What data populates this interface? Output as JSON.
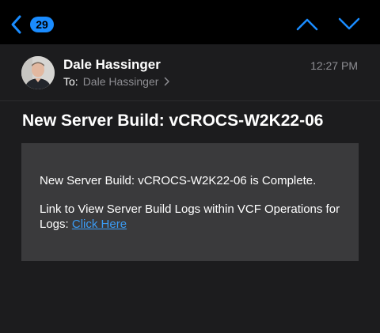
{
  "nav": {
    "unread_count": "29",
    "accent_color": "#1a8cff",
    "back_icon": "chevron-left-icon",
    "prev_icon": "chevron-up-icon",
    "next_icon": "chevron-down-icon"
  },
  "message": {
    "sender_name": "Dale Hassinger",
    "time": "12:27 PM",
    "to_label": "To:",
    "to_name": "Dale Hassinger",
    "subject": "New Server Build: vCROCS-W2K22-06",
    "body_line1": "New Server Build: vCROCS-W2K22-06 is Complete.",
    "body_line2": "Link to View Server Build Logs within VCF Operations for Logs: ",
    "link_text": "Click Here",
    "link_color": "#3a9cf5"
  }
}
